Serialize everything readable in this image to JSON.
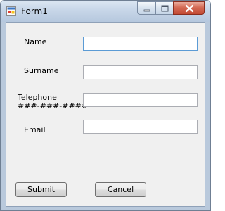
{
  "window": {
    "title": "Form1"
  },
  "form": {
    "name_label": "Name",
    "surname_label": "Surname",
    "telephone_label": "Telephone",
    "telephone_format": "###-###-####",
    "email_label": "Email",
    "name_value": "",
    "surname_value": "",
    "telephone_value": "",
    "email_value": ""
  },
  "buttons": {
    "submit": "Submit",
    "cancel": "Cancel"
  },
  "icons": {
    "app": "form-app-icon",
    "minimize": "minimize-icon",
    "maximize": "maximize-icon",
    "close": "close-icon"
  },
  "colors": {
    "close_button": "#c24a33",
    "client_background": "#f0f0f0",
    "focus_border": "#5b9bd5"
  }
}
